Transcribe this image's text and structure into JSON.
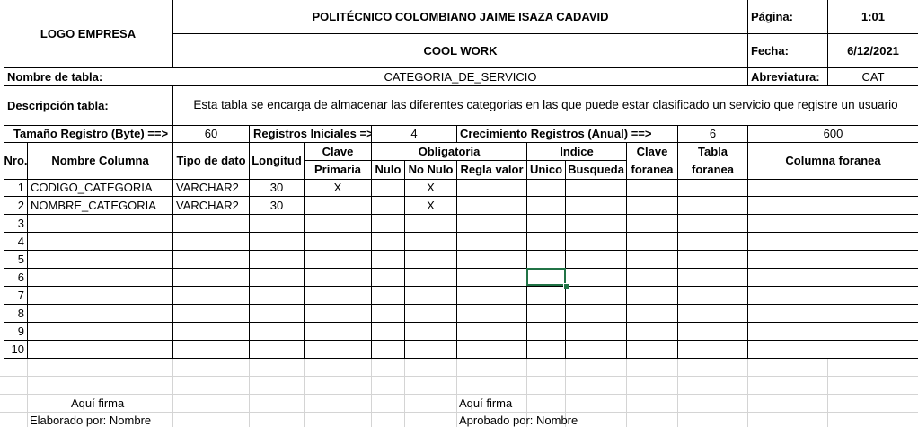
{
  "header": {
    "logo": "LOGO EMPRESA",
    "institution": "POLITÉCNICO COLOMBIANO JAIME ISAZA CADAVID",
    "project": "COOL WORK",
    "page_label": "Página:",
    "page_value": "1:01",
    "date_label": "Fecha:",
    "date_value": "6/12/2021"
  },
  "table_info": {
    "name_label": "Nombre de tabla:",
    "name_value": "CATEGORIA_DE_SERVICIO",
    "abbr_label": "Abreviatura:",
    "abbr_value": "CAT",
    "desc_label": "Descripción tabla:",
    "desc_value": "Esta tabla se encarga de almacenar las diferentes categorias en las que puede estar clasificado un servicio que registre un usuario"
  },
  "sizes": {
    "record_size_label": "Tamaño Registro (Byte) ==>",
    "record_size_value": "60",
    "initial_records_label": "Registros Iniciales =>",
    "initial_records_value": "4",
    "growth_label": "Crecimiento Registros (Anual) ==>",
    "growth_value": "6",
    "total_value": "600"
  },
  "columns_header": {
    "nro": "Nro.",
    "nombre": "Nombre Columna",
    "tipo": "Tipo de dato",
    "longitud": "Longitud",
    "clave": "Clave",
    "primaria": "Primaria",
    "obligatoria": "Obligatoria",
    "nulo": "Nulo",
    "no_nulo": "No Nulo",
    "regla": "Regla valor",
    "indice": "Indice",
    "unico": "Unico",
    "busqueda": "Busqueda",
    "clave2": "Clave",
    "foranea": "foranea",
    "tabla": "Tabla",
    "tabla_foranea": "foranea",
    "columna_foranea": "Columna foranea"
  },
  "rows": [
    {
      "nro": "1",
      "nombre": "CODIGO_CATEGORIA",
      "tipo": "VARCHAR2",
      "longitud": "30",
      "pk": "X",
      "nulo": "",
      "no_nulo": "X"
    },
    {
      "nro": "2",
      "nombre": "NOMBRE_CATEGORIA",
      "tipo": "VARCHAR2",
      "longitud": "30",
      "pk": "",
      "nulo": "",
      "no_nulo": "X"
    },
    {
      "nro": "3",
      "nombre": "",
      "tipo": "",
      "longitud": "",
      "pk": "",
      "nulo": "",
      "no_nulo": ""
    },
    {
      "nro": "4",
      "nombre": "",
      "tipo": "",
      "longitud": "",
      "pk": "",
      "nulo": "",
      "no_nulo": ""
    },
    {
      "nro": "5",
      "nombre": "",
      "tipo": "",
      "longitud": "",
      "pk": "",
      "nulo": "",
      "no_nulo": ""
    },
    {
      "nro": "6",
      "nombre": "",
      "tipo": "",
      "longitud": "",
      "pk": "",
      "nulo": "",
      "no_nulo": ""
    },
    {
      "nro": "7",
      "nombre": "",
      "tipo": "",
      "longitud": "",
      "pk": "",
      "nulo": "",
      "no_nulo": ""
    },
    {
      "nro": "8",
      "nombre": "",
      "tipo": "",
      "longitud": "",
      "pk": "",
      "nulo": "",
      "no_nulo": ""
    },
    {
      "nro": "9",
      "nombre": "",
      "tipo": "",
      "longitud": "",
      "pk": "",
      "nulo": "",
      "no_nulo": ""
    },
    {
      "nro": "10",
      "nombre": "",
      "tipo": "",
      "longitud": "",
      "pk": "",
      "nulo": "",
      "no_nulo": ""
    }
  ],
  "footer": {
    "sign_left": "Aquí firma",
    "made_by": "Elaborado por: Nombre",
    "sign_right": "Aquí firma",
    "approved_by": "Aprobado por: Nombre"
  },
  "colors": {
    "gridline": "#d4d4d4",
    "border": "#000000",
    "selection": "#217346"
  }
}
